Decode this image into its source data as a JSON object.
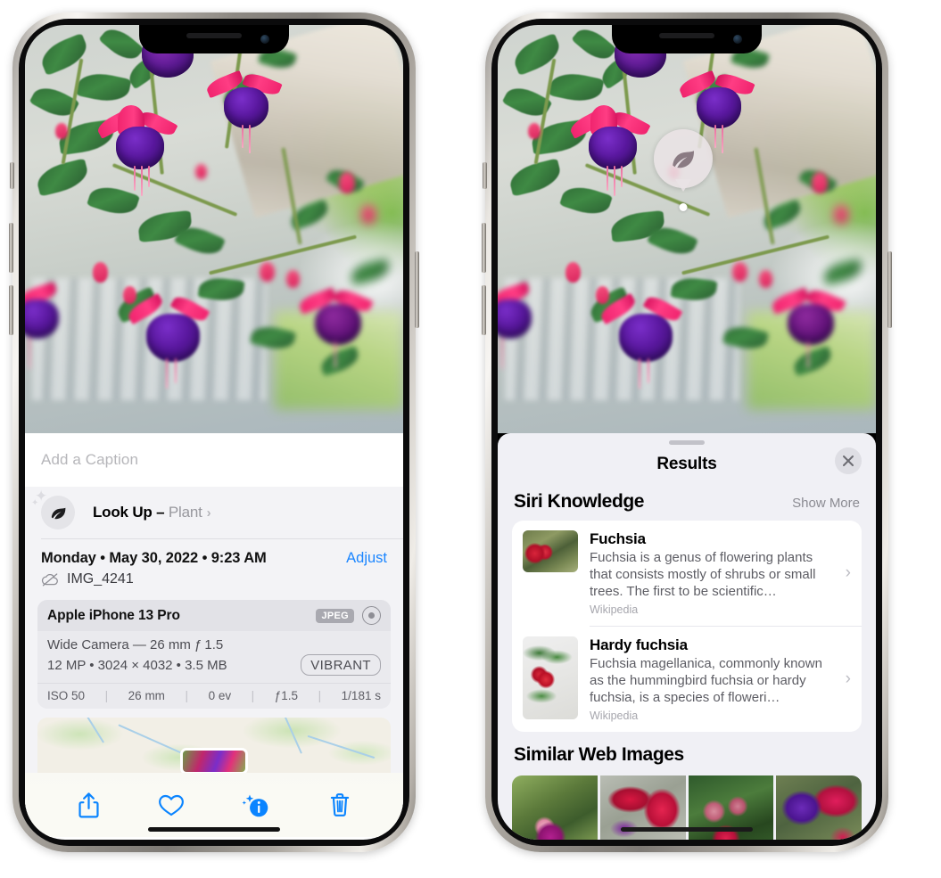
{
  "left_phone": {
    "name": "photos-detail-phone",
    "caption": {
      "placeholder": "Add a Caption",
      "value": ""
    },
    "lookup": {
      "label": "Look Up",
      "dash": "–",
      "subject": "Plant",
      "chevron": "›",
      "icon": "leaf-icon",
      "sparkle": "sparkle-icon"
    },
    "meta": {
      "date": "Monday • May 30, 2022 • 9:23 AM",
      "adjust_label": "Adjust",
      "filename": "IMG_4241",
      "cloud_icon": "cloud-slash-icon"
    },
    "camera_card": {
      "device": "Apple iPhone 13 Pro",
      "format_badge": "JPEG",
      "raw_icon": "aperture-icon",
      "lens_line": "Wide Camera — 26 mm ƒ 1.5",
      "specs_line": "12 MP • 3024 × 4032 • 3.5 MB",
      "style_badge": "VIBRANT",
      "exif": [
        "ISO 50",
        "26 mm",
        "0 ev",
        "ƒ1.5",
        "1/181 s"
      ]
    },
    "map": {
      "name": "location-map-preview",
      "thumb": "photo-location-thumbnail"
    },
    "toolbar": [
      {
        "name": "share-button",
        "icon": "share-icon"
      },
      {
        "name": "favorite-button",
        "icon": "heart-icon"
      },
      {
        "name": "info-button",
        "icon": "info-sparkle-icon"
      },
      {
        "name": "delete-button",
        "icon": "trash-icon"
      }
    ],
    "accent_color": "#0a84ff"
  },
  "right_phone": {
    "name": "visual-lookup-results-phone",
    "pin": {
      "icon": "leaf-icon",
      "name": "visual-lookup-pin"
    },
    "sheet": {
      "grabber": "drag-handle",
      "title": "Results",
      "close_icon": "close-icon"
    },
    "siri_knowledge": {
      "section_title": "Siri Knowledge",
      "show_more": "Show More",
      "items": [
        {
          "title": "Fuchsia",
          "description": "Fuchsia is a genus of flowering plants that consists mostly of shrubs or small trees. The first to be scientific…",
          "source": "Wikipedia",
          "chevron": "›"
        },
        {
          "title": "Hardy fuchsia",
          "description": "Fuchsia magellanica, commonly known as the hummingbird fuchsia or hardy fuchsia, is a species of floweri…",
          "source": "Wikipedia",
          "chevron": "›"
        }
      ]
    },
    "similar_web_images": {
      "section_title": "Similar Web Images",
      "count": 4
    },
    "sheet_bg_color": "#f0f0f5"
  }
}
